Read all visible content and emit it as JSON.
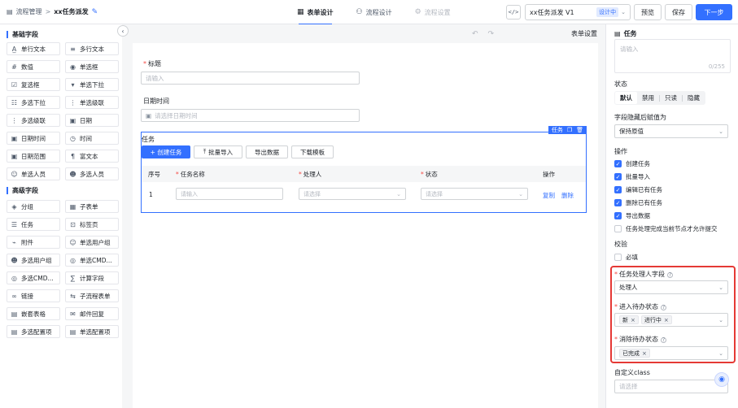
{
  "header": {
    "crumb_parent": "流程管理",
    "separator": ">",
    "title": "xx任务派发",
    "tabs": [
      {
        "label": "表单设计",
        "icon": "form-icon",
        "state": "active"
      },
      {
        "label": "流程设计",
        "icon": "flow-icon",
        "state": "normal"
      },
      {
        "label": "流程设置",
        "icon": "settings-icon",
        "state": "disabled"
      }
    ],
    "code_label": "</>",
    "version_name": "xx任务派发 V1",
    "version_status": "设计中",
    "preview_label": "预览",
    "save_label": "保存",
    "next_label": "下一步",
    "accent_color": "#3370ff"
  },
  "palette": {
    "basic_title": "基础字段",
    "basic_fields": [
      {
        "label": "单行文本",
        "icon": "text-line-icon"
      },
      {
        "label": "多行文本",
        "icon": "text-multi-icon"
      },
      {
        "label": "数值",
        "icon": "number-icon"
      },
      {
        "label": "单选框",
        "icon": "radio-icon"
      },
      {
        "label": "复选框",
        "icon": "checkbox-icon"
      },
      {
        "label": "单选下拉",
        "icon": "select-icon"
      },
      {
        "label": "多选下拉",
        "icon": "multi-select-icon"
      },
      {
        "label": "单选级联",
        "icon": "cascade-icon"
      },
      {
        "label": "多选级联",
        "icon": "multi-cascade-icon"
      },
      {
        "label": "日期",
        "icon": "date-icon"
      },
      {
        "label": "日期时间",
        "icon": "datetime-icon"
      },
      {
        "label": "时间",
        "icon": "clock-icon"
      },
      {
        "label": "日期范围",
        "icon": "date-range-icon"
      },
      {
        "label": "富文本",
        "icon": "richtext-icon"
      },
      {
        "label": "单选人员",
        "icon": "user-icon"
      },
      {
        "label": "多选人员",
        "icon": "users-icon"
      }
    ],
    "advanced_title": "高级字段",
    "advanced_fields": [
      {
        "label": "分组",
        "icon": "group-icon"
      },
      {
        "label": "子表单",
        "icon": "subform-icon"
      },
      {
        "label": "任务",
        "icon": "task-icon"
      },
      {
        "label": "标签页",
        "icon": "tabs-icon"
      },
      {
        "label": "附件",
        "icon": "attachment-icon"
      },
      {
        "label": "单选用户组",
        "icon": "usergroup-icon"
      },
      {
        "label": "多选用户组",
        "icon": "usergroups-icon"
      },
      {
        "label": "单选CMD...",
        "icon": "cmdb-icon"
      },
      {
        "label": "多选CMD...",
        "icon": "cmdb-multi-icon"
      },
      {
        "label": "计算字段",
        "icon": "calc-icon"
      },
      {
        "label": "链接",
        "icon": "link-icon"
      },
      {
        "label": "子流程表单",
        "icon": "subflow-icon"
      },
      {
        "label": "嵌套表格",
        "icon": "nested-table-icon"
      },
      {
        "label": "邮件回复",
        "icon": "mail-icon"
      },
      {
        "label": "多选配置项",
        "icon": "config-multi-icon"
      },
      {
        "label": "单选配置项",
        "icon": "config-icon"
      }
    ]
  },
  "canvas": {
    "settings_label": "表单设置",
    "title_field": {
      "label": "标题",
      "required": true,
      "placeholder": "请输入"
    },
    "date_field": {
      "label": "日期时间",
      "placeholder": "请选择日期时间"
    },
    "task": {
      "sel_tag": "任务",
      "title": "任务",
      "buttons": {
        "create": "+ 创建任务",
        "import": "批量导入",
        "export": "导出数据",
        "template": "下载模板"
      },
      "columns": [
        "序号",
        "任务名称",
        "处理人",
        "状态",
        "操作"
      ],
      "row": {
        "index": "1",
        "name_placeholder": "请输入",
        "handler_placeholder": "请选择",
        "status_placeholder": "请选择",
        "copy": "复制",
        "delete": "删除"
      }
    }
  },
  "panel": {
    "title": "任务",
    "textarea_placeholder": "请输入",
    "char_count": "0/255",
    "state_label": "状态",
    "states": [
      {
        "label": "默认",
        "on": true
      },
      {
        "label": "禁用",
        "on": false
      },
      {
        "label": "只读",
        "on": false
      },
      {
        "label": "隐藏",
        "on": false
      }
    ],
    "hidden_value_label": "字段隐藏后赋值为",
    "hidden_value": "保持原值",
    "ops_label": "操作",
    "ops": [
      {
        "label": "创建任务",
        "checked": true
      },
      {
        "label": "批量导入",
        "checked": true
      },
      {
        "label": "编辑已有任务",
        "checked": true
      },
      {
        "label": "删除已有任务",
        "checked": true
      },
      {
        "label": "导出数据",
        "checked": true
      },
      {
        "label": "任务处理完成当前节点才允许提交",
        "checked": false
      }
    ],
    "validate_label": "校验",
    "required_label": "必填",
    "handler_field_label": "任务处理人字段",
    "handler_field_value": "处理人",
    "enter_state_label": "进入待办状态",
    "enter_state_tags": [
      "新",
      "进行中"
    ],
    "exit_state_label": "消除待办状态",
    "exit_state_tags": [
      "已完成"
    ],
    "custom_class_label": "自定义class",
    "custom_class_placeholder": "请选择",
    "highlight_color": "#e53935"
  }
}
